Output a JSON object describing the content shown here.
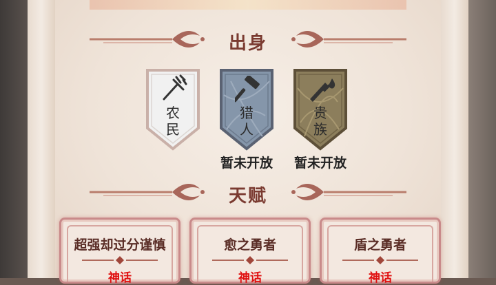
{
  "sections": {
    "origin_title": "出身",
    "talent_title": "天赋"
  },
  "origins": [
    {
      "name_line1": "农",
      "name_line2": "民",
      "icon": "pitchfork-icon",
      "status": "",
      "color": "#f2f2f2"
    },
    {
      "name_line1": "猎",
      "name_line2": "人",
      "icon": "hammer-icon",
      "status": "暂未开放",
      "color": "#8392a6"
    },
    {
      "name_line1": "贵",
      "name_line2": "族",
      "icon": "sword-icon",
      "status": "暂未开放",
      "color": "#8a7c5a"
    }
  ],
  "talents": [
    {
      "name": "超强却过分谨慎",
      "rarity": "神话"
    },
    {
      "name": "愈之勇者",
      "rarity": "神话"
    },
    {
      "name": "盾之勇者",
      "rarity": "神话"
    }
  ],
  "colors": {
    "title": "#7a3a30",
    "rarity": "#e01010",
    "card_border": "#c98a8a"
  }
}
